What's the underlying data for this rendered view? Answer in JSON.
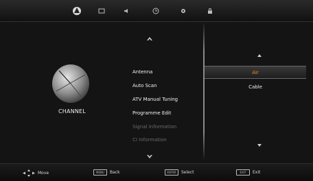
{
  "top_menu": {
    "icons": [
      "channel-icon",
      "picture-icon",
      "sound-icon",
      "time-icon",
      "setup-icon",
      "lock-icon"
    ]
  },
  "section": {
    "title": "CHANNEL"
  },
  "menu": {
    "items": [
      {
        "label": "Antenna"
      },
      {
        "label": "Auto Scan"
      },
      {
        "label": "ATV Manual Tuning"
      },
      {
        "label": "Programme Edit"
      },
      {
        "label": "Signal Information"
      },
      {
        "label": "CI Information"
      }
    ]
  },
  "submenu": {
    "options": [
      {
        "label": "Air",
        "selected": true
      },
      {
        "label": "Cable",
        "selected": false
      }
    ],
    "selected_color": "#ff8a1a"
  },
  "hints": {
    "move": "Move",
    "back_key": "MENU",
    "back": "Back",
    "select_key": "ENTER",
    "select": "Select",
    "exit_key": "EXIT",
    "exit": "Exit"
  }
}
